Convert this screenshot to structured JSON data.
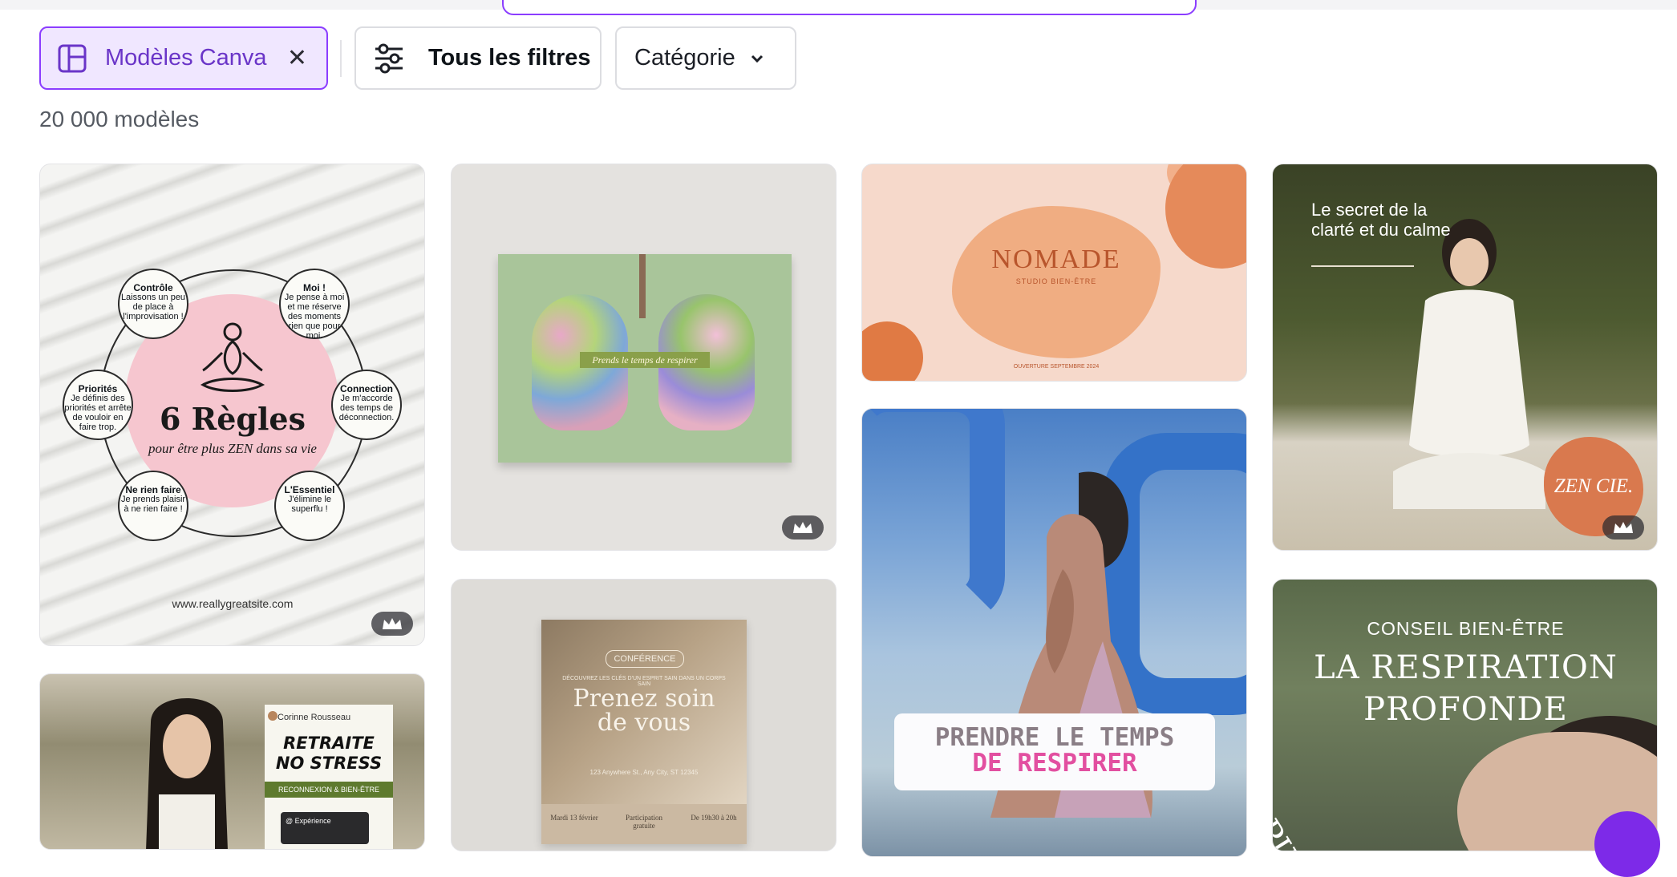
{
  "filters": {
    "canva_chip_label": "Modèles Canva",
    "all_filters_label": "Tous les filtres",
    "category_label": "Catégorie"
  },
  "result_count": "20 000 modèles",
  "colors": {
    "accent": "#8b3dff",
    "chip_bg": "#f0e7ff",
    "premium_badge": "#28282e"
  },
  "cards": {
    "c1": {
      "title": "6 Règles",
      "subtitle": "pour être plus ZEN dans sa vie",
      "url": "www.reallygreatsite.com",
      "bubbles": [
        {
          "head": "Contrôle",
          "body": "Laissons un peu de place à l'improvisation !"
        },
        {
          "head": "Moi !",
          "body": "Je pense à moi et me réserve des moments rien que pour moi."
        },
        {
          "head": "Priorités",
          "body": "Je définis des priorités et arrête de vouloir en faire trop."
        },
        {
          "head": "Connection",
          "body": "Je m'accorde des temps de déconnection."
        },
        {
          "head": "Ne rien faire",
          "body": "Je prends plaisir à ne rien faire !"
        },
        {
          "head": "L'Essentiel",
          "body": "J'élimine le superflu !"
        }
      ],
      "premium": true
    },
    "c2": {
      "band_text": "Prends le temps de respirer",
      "premium": true
    },
    "c3": {
      "brand": "NOMADE",
      "tagline": "STUDIO BIEN-ÊTRE",
      "opening": "OUVERTURE SEPTEMBRE 2024",
      "premium": false
    },
    "c4": {
      "headline": "Le secret de la clarté et du calme",
      "badge": "ZEN CIE.",
      "premium": true
    },
    "c5": {
      "author": "Corinne Rousseau",
      "title_line1": "RETRAITE",
      "title_line2": "NO STRESS",
      "tag": "RECONNEXION & BIEN-ÊTRE",
      "note": "@ Expérience"
    },
    "c6": {
      "pill": "CONFÉRENCE",
      "description": "DÉCOUVREZ LES CLÉS D'UN ESPRIT SAIN DANS UN CORPS SAIN",
      "title_line1": "Prenez soin",
      "title_line2": "de vous",
      "address": "123 Anywhere St., Any City, ST 12345",
      "date": "Mardi 13 février",
      "participation": "Participation gratuite",
      "time": "De 19h30 à 20h"
    },
    "c7": {
      "line1": "PRENDRE LE TEMPS",
      "line2": "DE RESPIRER"
    },
    "c8": {
      "kicker": "CONSEIL BIEN-ÊTRE",
      "title_line1": "LA RESPIRATION",
      "title_line2": "PROFONDE",
      "arc_text": "SPIRE"
    }
  },
  "icons": [
    "template-icon",
    "close-icon",
    "sliders-icon",
    "chevron-down-icon",
    "crown-icon"
  ]
}
